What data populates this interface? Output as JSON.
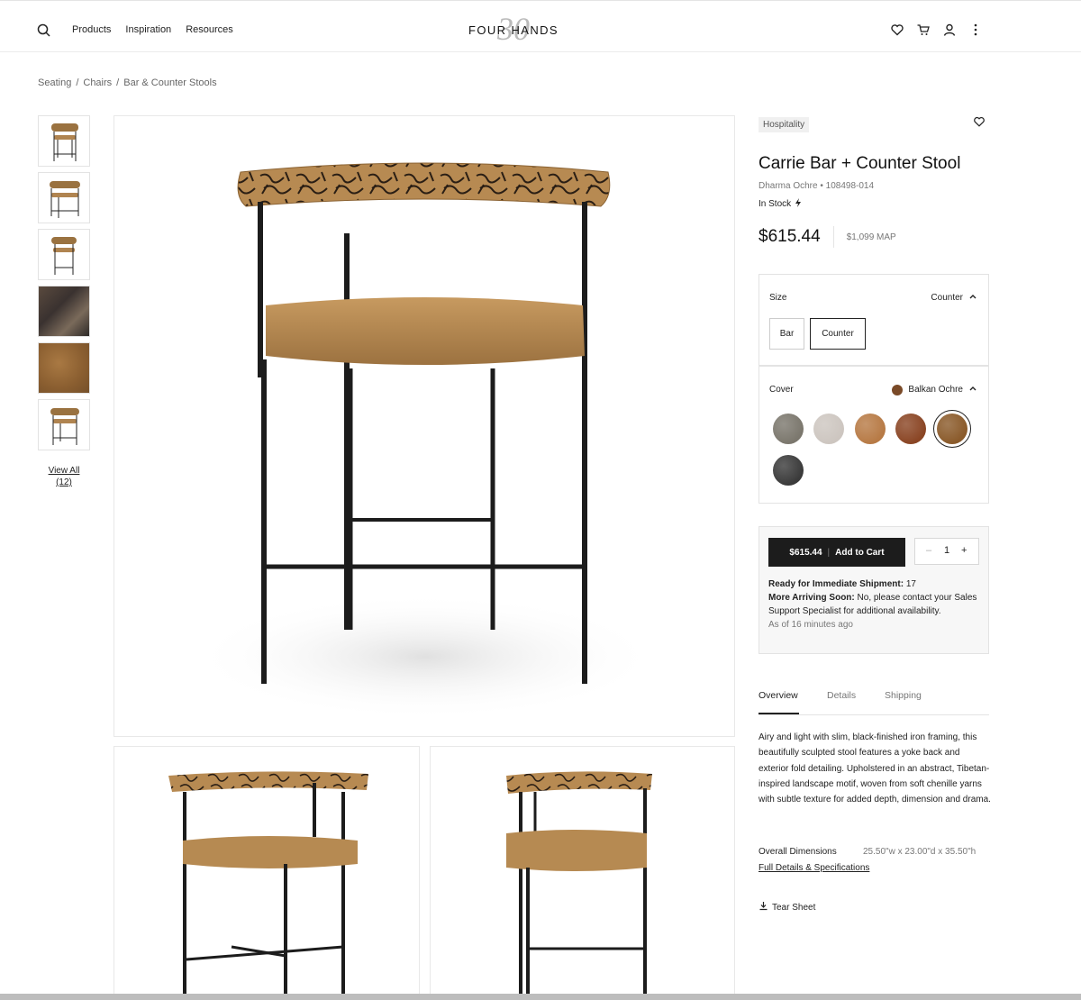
{
  "header": {
    "nav": [
      "Products",
      "Inspiration",
      "Resources"
    ],
    "logo_mark": "30",
    "logo_text": "FOUR HANDS",
    "icons": [
      "search-icon",
      "heart-icon",
      "cart-icon",
      "account-icon",
      "more-icon"
    ]
  },
  "breadcrumb": [
    "Seating",
    "/",
    "Chairs",
    "/",
    "Bar & Counter Stools"
  ],
  "gallery": {
    "view_all": "View All",
    "count": "(12)"
  },
  "product": {
    "badge": "Hospitality",
    "title": "Carrie Bar + Counter Stool",
    "subtitle": "Dharma Ochre • 108498-014",
    "stock": "In Stock",
    "price": "$615.44",
    "map_price": "$1,099 MAP"
  },
  "size": {
    "label": "Size",
    "selected": "Counter",
    "options": [
      "Bar",
      "Counter"
    ]
  },
  "cover": {
    "label": "Cover",
    "selected": "Balkan Ochre",
    "selected_color": "#7a4a28",
    "swatches": [
      "#7b776d",
      "#cdc6c0",
      "#b77a45",
      "#8a4524",
      "#8a5a2a",
      "#3a3a3a"
    ]
  },
  "cart": {
    "price": "$615.44",
    "label": "Add to Cart",
    "qty": "1",
    "minus": "–",
    "plus": "+",
    "ready_label": "Ready for Immediate Shipment:",
    "ready_value": "17",
    "arriving_label": "More Arriving Soon:",
    "arriving_value": "No, please contact your Sales Support Specialist for additional availability.",
    "as_of": "As of 16 minutes ago"
  },
  "tabs": [
    "Overview",
    "Details",
    "Shipping"
  ],
  "overview": "Airy and light with slim, black-finished iron framing, this beautifully sculpted stool features a yoke back and exterior fold detailing. Upholstered in an abstract, Tibetan-inspired landscape motif, woven from soft chenille yarns with subtle texture for added depth, dimension and drama.",
  "dimensions": {
    "label": "Overall Dimensions",
    "value": "25.50\"w x 23.00\"d x 35.50\"h",
    "link": "Full Details & Specifications"
  },
  "tear_sheet": "Tear Sheet"
}
